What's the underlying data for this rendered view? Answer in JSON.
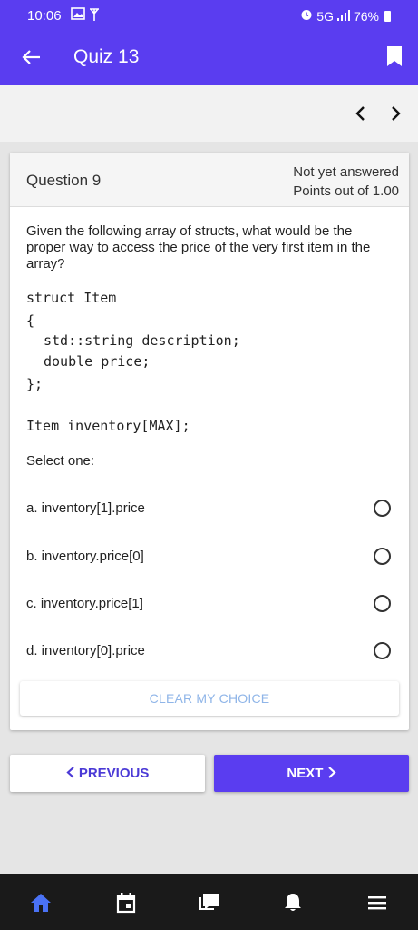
{
  "status_bar": {
    "time": "10:06",
    "network": "5G",
    "battery": "76%",
    "icons": [
      "image-icon",
      "antenna-icon",
      "alarm-icon",
      "signal-icon",
      "battery-icon"
    ]
  },
  "app_bar": {
    "title": "Quiz 13",
    "back_icon": "arrow-left-icon",
    "bookmark_icon": "bookmark-icon"
  },
  "nav": {
    "prev_icon": "chevron-left-icon",
    "next_icon": "chevron-right-icon"
  },
  "question": {
    "number": "Question 9",
    "status": "Not yet answered",
    "points": "Points out of 1.00",
    "text": "Given the following array of structs, what would be the proper way to access the price of the very first item in the array?",
    "code": [
      "struct Item",
      "{",
      "std::string description;",
      "double price;",
      "};",
      "Item inventory[MAX];"
    ],
    "prompt": "Select one:",
    "options": [
      {
        "label": "a. inventory[1].price",
        "selected": false
      },
      {
        "label": "b. inventory.price[0]",
        "selected": false
      },
      {
        "label": "c. inventory.price[1]",
        "selected": false
      },
      {
        "label": "d. inventory[0].price",
        "selected": false
      }
    ],
    "clear_label": "CLEAR MY CHOICE"
  },
  "pager": {
    "previous_label": "PREVIOUS",
    "next_label": "NEXT"
  },
  "bottom_nav": {
    "items": [
      "home-icon",
      "calendar-icon",
      "messages-icon",
      "notifications-icon",
      "menu-icon"
    ]
  },
  "colors": {
    "primary": "#5a3df0",
    "link": "#4b3ad6",
    "clear_text": "#8fb5e8",
    "nav_bg": "#1a1a1a"
  }
}
